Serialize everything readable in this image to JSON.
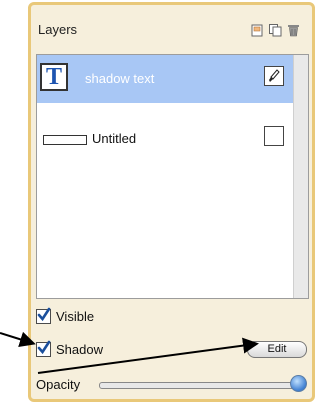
{
  "panel": {
    "title": "Layers",
    "toolbar": [
      "new-layer-icon",
      "duplicate-layer-icon",
      "trash-icon"
    ]
  },
  "layers": [
    {
      "name": "shadow text",
      "kind": "text",
      "thumb_glyph": "T",
      "selected": true,
      "edit_icon": "brush-icon"
    },
    {
      "name": "Untitled",
      "kind": "shape",
      "selected": false
    }
  ],
  "options": {
    "visible_label": "Visible",
    "visible_checked": true,
    "shadow_label": "Shadow",
    "shadow_checked": true,
    "edit_label": "Edit",
    "opacity_label": "Opacity",
    "opacity_value": 1.0
  },
  "colors": {
    "accent": "#a8c7f5",
    "panel": "#f6efdc",
    "border": "#e9c879",
    "text_glyph": "#1d54b0"
  }
}
